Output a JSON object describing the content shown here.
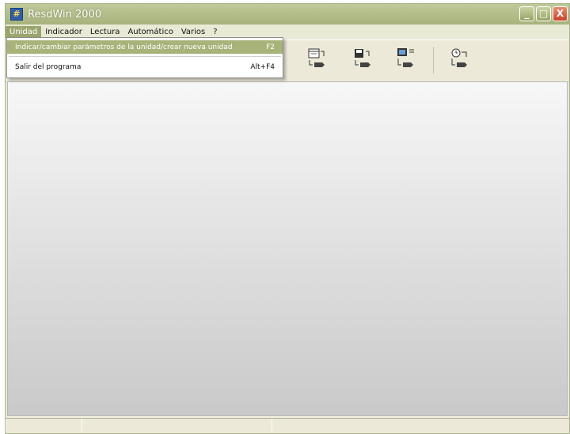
{
  "window": {
    "title": "ResdWin 2000"
  },
  "titlebar": {
    "minimize_glyph": "_",
    "maximize_glyph": "□",
    "close_glyph": "X",
    "icon": "app-icon"
  },
  "menubar": {
    "items": [
      {
        "label": "Unidad",
        "active": true
      },
      {
        "label": "Indicador"
      },
      {
        "label": "Lectura"
      },
      {
        "label": "Automático"
      },
      {
        "label": "Varios"
      },
      {
        "label": "?"
      }
    ]
  },
  "dropdown": {
    "items": [
      {
        "label": "Indicar/cambiar parámetros de la unidad/crear nueva unidad",
        "shortcut": "F2",
        "highlighted": true
      },
      {
        "label": "Salir del programa",
        "shortcut": "Alt+F4"
      }
    ]
  },
  "toolbar": {
    "buttons": [
      {
        "icon": "calendar-icon"
      },
      {
        "icon": "save-icon"
      },
      {
        "icon": "monitor-icon"
      },
      {
        "icon": "clock-icon"
      }
    ]
  },
  "colors": {
    "titlebar": "#a7b37c",
    "menu_highlight": "#a8b37a",
    "client_background": "#e6e6e6"
  }
}
